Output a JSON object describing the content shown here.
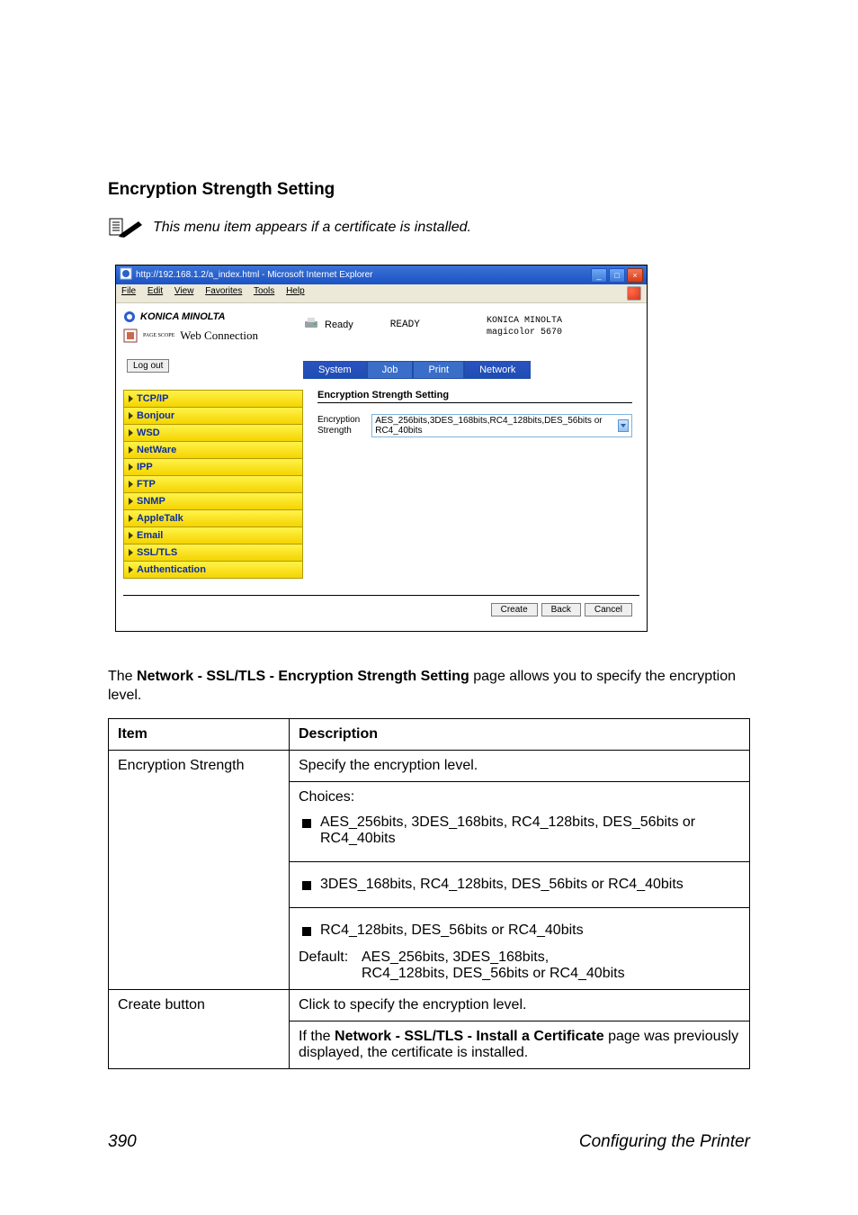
{
  "heading": "Encryption Strength Setting",
  "note": "This menu item appears if a certificate is installed.",
  "screenshot": {
    "window_title": "http://192.168.1.2/a_index.html - Microsoft Internet Explorer",
    "menu": {
      "file": "File",
      "edit": "Edit",
      "view": "View",
      "favorites": "Favorites",
      "tools": "Tools",
      "help": "Help"
    },
    "brand": "KONICA MINOLTA",
    "web_connection_label": "Web Connection",
    "page_scope_label": "PAGE SCOPE",
    "status_label": "Ready",
    "ready_banner": "READY",
    "device_maker": "KONICA MINOLTA",
    "device_model": "magicolor 5670",
    "logout": "Log out",
    "tabs": [
      "System",
      "Job",
      "Print",
      "Network"
    ],
    "sidebar": [
      "TCP/IP",
      "Bonjour",
      "WSD",
      "NetWare",
      "IPP",
      "FTP",
      "SNMP",
      "AppleTalk",
      "Email",
      "SSL/TLS",
      "Authentication"
    ],
    "content_title": "Encryption Strength Setting",
    "field_label": "Encryption Strength",
    "field_value": "AES_256bits,3DES_168bits,RC4_128bits,DES_56bits or RC4_40bits",
    "footer_buttons": [
      "Create",
      "Back",
      "Cancel"
    ]
  },
  "paragraph_prefix": "The ",
  "paragraph_bold": "Network - SSL/TLS - Encryption Strength Setting",
  "paragraph_suffix": " page allows you to specify the encryption level.",
  "table": {
    "h1": "Item",
    "h2": "Description",
    "r1c1": "Encryption Strength",
    "r1_l1": "Specify the encryption level.",
    "r1_l2": "Choices:",
    "choices": [
      "AES_256bits, 3DES_168bits, RC4_128bits, DES_56bits or RC4_40bits",
      "3DES_168bits, RC4_128bits, DES_56bits or RC4_40bits",
      "RC4_128bits, DES_56bits or RC4_40bits"
    ],
    "default_label": "Default:",
    "default_l1": "AES_256bits, 3DES_168bits,",
    "default_l2": "RC4_128bits, DES_56bits or RC4_40bits",
    "r2c1": "Create button",
    "r2_l1": "Click to specify the encryption level.",
    "r2_l2a": "If the ",
    "r2_l2b": "Network - SSL/TLS - Install a Certificate",
    "r2_l2c": " page was previously displayed, the certificate is installed."
  },
  "footer": {
    "page_num": "390",
    "section": "Configuring the Printer"
  }
}
